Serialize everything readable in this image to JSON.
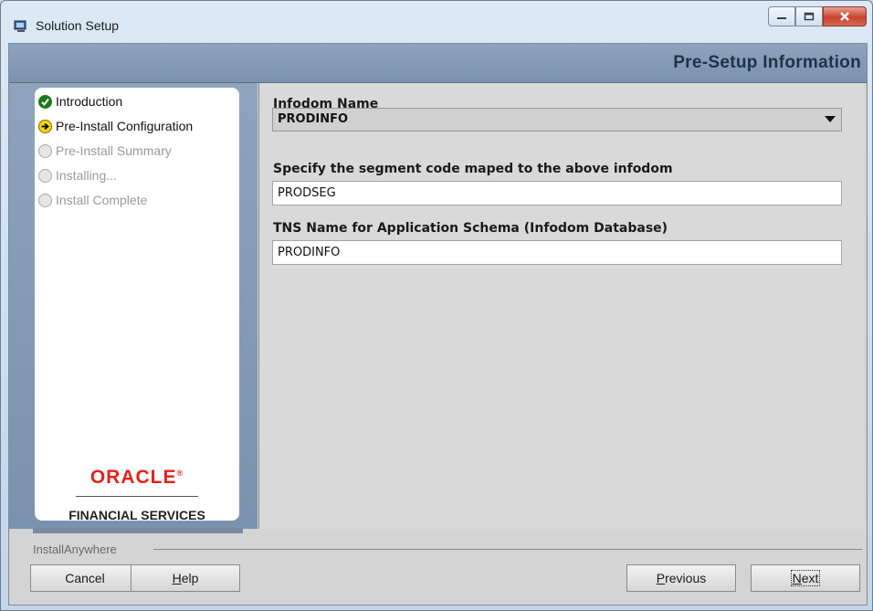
{
  "window": {
    "title": "Solution Setup"
  },
  "header": {
    "title": "Pre-Setup Information"
  },
  "steps": [
    {
      "label": "Introduction",
      "state": "done"
    },
    {
      "label": "Pre-Install Configuration",
      "state": "current"
    },
    {
      "label": "Pre-Install Summary",
      "state": "pending"
    },
    {
      "label": "Installing...",
      "state": "pending"
    },
    {
      "label": "Install Complete",
      "state": "pending"
    }
  ],
  "branding": {
    "oracle": "ORACLE",
    "registered": "®",
    "subtitle": "FINANCIAL SERVICES"
  },
  "form": {
    "infodom_label": "Infodom Name",
    "infodom_value": "PRODINFO",
    "segment_label": "Specify the segment code maped to the above infodom",
    "segment_value": "PRODSEG",
    "tns_label": "TNS Name for Application Schema (Infodom Database)",
    "tns_value": "PRODINFO"
  },
  "footer": {
    "installer_name": "InstallAnywhere",
    "cancel": "Cancel",
    "help_mnemonic": "H",
    "help_rest": "elp",
    "previous_mnemonic": "P",
    "previous_rest": "revious",
    "next_mnemonic": "N",
    "next_rest": "ext"
  },
  "colors": {
    "accent": "#7a92ad",
    "oracle_red": "#e2231a",
    "done": "#1c7a1c",
    "current": "#f5d800"
  }
}
